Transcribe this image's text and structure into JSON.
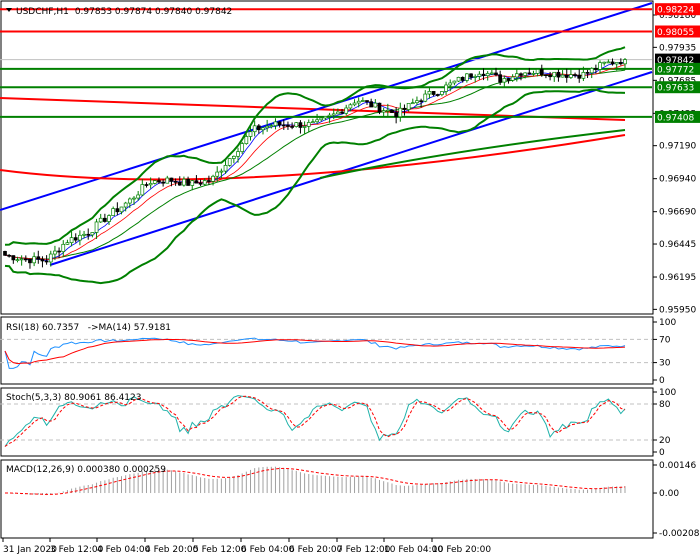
{
  "header": {
    "symbol": "USDCHF,H1",
    "ohlc": "0.97853 0.97874 0.97840 0.97842"
  },
  "colors": {
    "support": "#008000",
    "resistance": "#ff0000",
    "channel": "#0000ff",
    "bull": "#008000",
    "bear": "#000000"
  },
  "chart_data": [
    {
      "type": "candlestick",
      "title": "USDCHF,H1",
      "y_ticks": [
        "0.98180",
        "0.97935",
        "0.97685",
        "0.97435",
        "0.97190",
        "0.96940",
        "0.96690",
        "0.96445",
        "0.96195",
        "0.95950"
      ],
      "ylim": [
        0.9595,
        0.9824
      ],
      "x_ticks": [
        "31 Jan 2020",
        "3 Feb 12:00",
        "4 Feb 04:00",
        "4 Feb 20:00",
        "5 Feb 12:00",
        "6 Feb 04:00",
        "6 Feb 20:00",
        "7 Feb 12:00",
        "10 Feb 04:00",
        "10 Feb 20:00"
      ],
      "close_keypoints": [
        0.9636,
        0.9633,
        0.9632,
        0.9647,
        0.9653,
        0.9666,
        0.9677,
        0.9692,
        0.9693,
        0.969,
        0.9693,
        0.9712,
        0.9731,
        0.9735,
        0.9735,
        0.9735,
        0.9743,
        0.9754,
        0.9748,
        0.9743,
        0.9754,
        0.9761,
        0.9769,
        0.9776,
        0.9769,
        0.9775,
        0.9775,
        0.9773,
        0.9773,
        0.9781,
        0.97842
      ],
      "levels": [
        {
          "label": "0.98224",
          "value": 0.98224,
          "kind": "resistance"
        },
        {
          "label": "0.98055",
          "value": 0.98055,
          "kind": "resistance"
        },
        {
          "label": "0.97842",
          "value": 0.97842,
          "kind": "current"
        },
        {
          "label": "0.97772",
          "value": 0.97772,
          "kind": "support"
        },
        {
          "label": "0.97633",
          "value": 0.97633,
          "kind": "support"
        },
        {
          "label": "0.97408",
          "value": 0.97408,
          "kind": "support"
        }
      ]
    },
    {
      "type": "line",
      "title": "RSI(18) 60.7357   ->MA(14) 57.9181",
      "y_ticks": [
        "100",
        "70",
        "30",
        "0"
      ],
      "ylim": [
        0,
        100
      ],
      "levels": [
        70,
        30
      ]
    },
    {
      "type": "line",
      "title": "Stoch(5,3,3) 80.9061 86.4123",
      "y_ticks": [
        "100",
        "80",
        "20",
        "0"
      ],
      "ylim": [
        0,
        100
      ],
      "levels": [
        80,
        20
      ]
    },
    {
      "type": "bar",
      "title": "MACD(12,26,9) 0.000380 0.000259",
      "y_ticks": [
        "0.00146",
        "0.00",
        "-0.002082"
      ],
      "ylim": [
        -0.002082,
        0.00146
      ]
    }
  ]
}
